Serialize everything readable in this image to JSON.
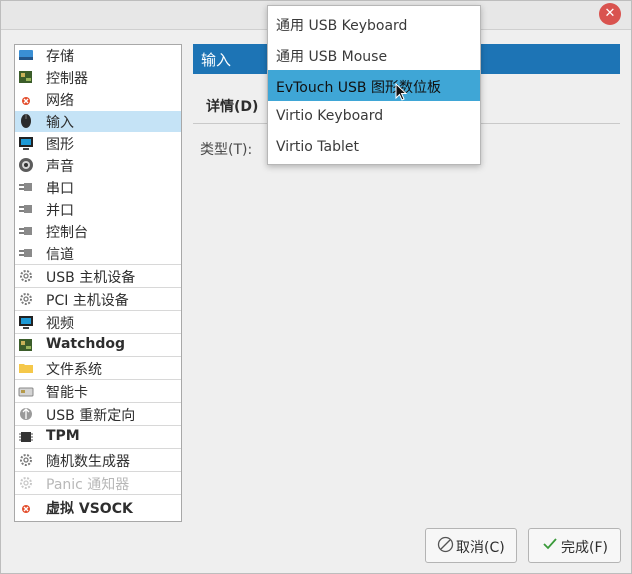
{
  "window": {
    "close_icon": "close-icon"
  },
  "sidebar": {
    "items": [
      {
        "label": "存储",
        "icon": "storage-icon"
      },
      {
        "label": "控制器",
        "icon": "controller-card-icon"
      },
      {
        "label": "网络",
        "icon": "network-error-icon"
      },
      {
        "label": "输入",
        "icon": "mouse-icon",
        "selected": true
      },
      {
        "label": "图形",
        "icon": "monitor-icon"
      },
      {
        "label": "声音",
        "icon": "speaker-icon"
      },
      {
        "label": "串口",
        "icon": "serial-plug-icon"
      },
      {
        "label": "并口",
        "icon": "parallel-plug-icon"
      },
      {
        "label": "控制台",
        "icon": "console-plug-icon"
      },
      {
        "label": "信道",
        "icon": "channel-plug-icon"
      },
      {
        "label": "USB 主机设备",
        "icon": "gear-icon"
      },
      {
        "label": "PCI 主机设备",
        "icon": "gear-icon"
      },
      {
        "label": "视频",
        "icon": "monitor-icon"
      },
      {
        "label": "Watchdog",
        "icon": "watchdog-card-icon"
      },
      {
        "label": "文件系统",
        "icon": "folder-icon"
      },
      {
        "label": "智能卡",
        "icon": "smartcard-icon"
      },
      {
        "label": "USB 重新定向",
        "icon": "usb-redirect-icon"
      },
      {
        "label": "TPM",
        "icon": "chip-icon"
      },
      {
        "label": "随机数生成器",
        "icon": "gear-icon"
      },
      {
        "label": "Panic 通知器",
        "icon": "gear-icon",
        "disabled": true
      },
      {
        "label": "虚拟 VSOCK",
        "icon": "network-error-icon"
      }
    ]
  },
  "content": {
    "title": "输入",
    "tab_details": "详情(D)",
    "type_label": "类型(T):"
  },
  "dropdown": {
    "options": [
      {
        "label": "通用 USB Keyboard"
      },
      {
        "label": "通用 USB Mouse"
      },
      {
        "label": "EvTouch USB 图形数位板",
        "selected": true
      },
      {
        "label": "Virtio Keyboard"
      },
      {
        "label": "Virtio Tablet"
      }
    ]
  },
  "buttons": {
    "cancel": "取消(C)",
    "finish": "完成(F)"
  }
}
